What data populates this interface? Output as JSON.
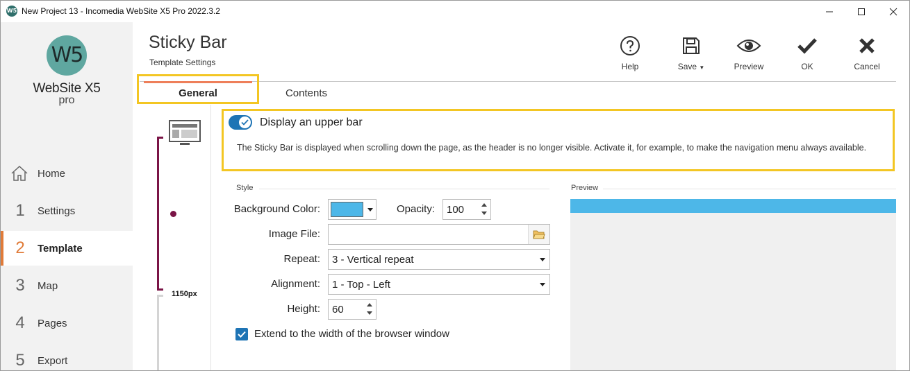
{
  "window": {
    "app_icon_text": "W5",
    "title": "New Project 13 - Incomedia WebSite X5 Pro 2022.3.2"
  },
  "sidebar": {
    "logo_mark": "W5",
    "logo_text": "WebSite X5",
    "logo_sub": "pro",
    "items": [
      {
        "num": "",
        "label": "Home",
        "icon": "home-icon"
      },
      {
        "num": "1",
        "label": "Settings"
      },
      {
        "num": "2",
        "label": "Template",
        "active": true
      },
      {
        "num": "3",
        "label": "Map"
      },
      {
        "num": "4",
        "label": "Pages"
      },
      {
        "num": "5",
        "label": "Export"
      }
    ]
  },
  "header": {
    "title": "Sticky Bar",
    "subtitle": "Template Settings"
  },
  "toolbar": {
    "help": "Help",
    "save": "Save",
    "preview": "Preview",
    "ok": "OK",
    "cancel": "Cancel"
  },
  "tabs": [
    {
      "label": "General",
      "active": true
    },
    {
      "label": "Contents"
    }
  ],
  "strip": {
    "width_label": "1150px"
  },
  "upper_bar": {
    "toggle_label": "Display an upper bar",
    "enabled": true,
    "description": "The Sticky Bar is displayed when scrolling down the page, as the header is no longer visible. Activate it, for example, to make the navigation menu always available."
  },
  "style": {
    "section_label": "Style",
    "background_color_label": "Background Color:",
    "background_color": "#4db7e8",
    "opacity_label": "Opacity:",
    "opacity_value": "100",
    "image_file_label": "Image File:",
    "image_file_value": "",
    "repeat_label": "Repeat:",
    "repeat_value": "3 - Vertical repeat",
    "alignment_label": "Alignment:",
    "alignment_value": "1 - Top - Left",
    "height_label": "Height:",
    "height_value": "60",
    "extend_label": "Extend to the width of the browser window",
    "extend_checked": true
  },
  "preview": {
    "section_label": "Preview"
  },
  "colors": {
    "accent_orange": "#e07b39",
    "highlight_yellow": "#f3c623",
    "toggle_blue": "#1e74b5",
    "bracket_maroon": "#7a1446"
  }
}
